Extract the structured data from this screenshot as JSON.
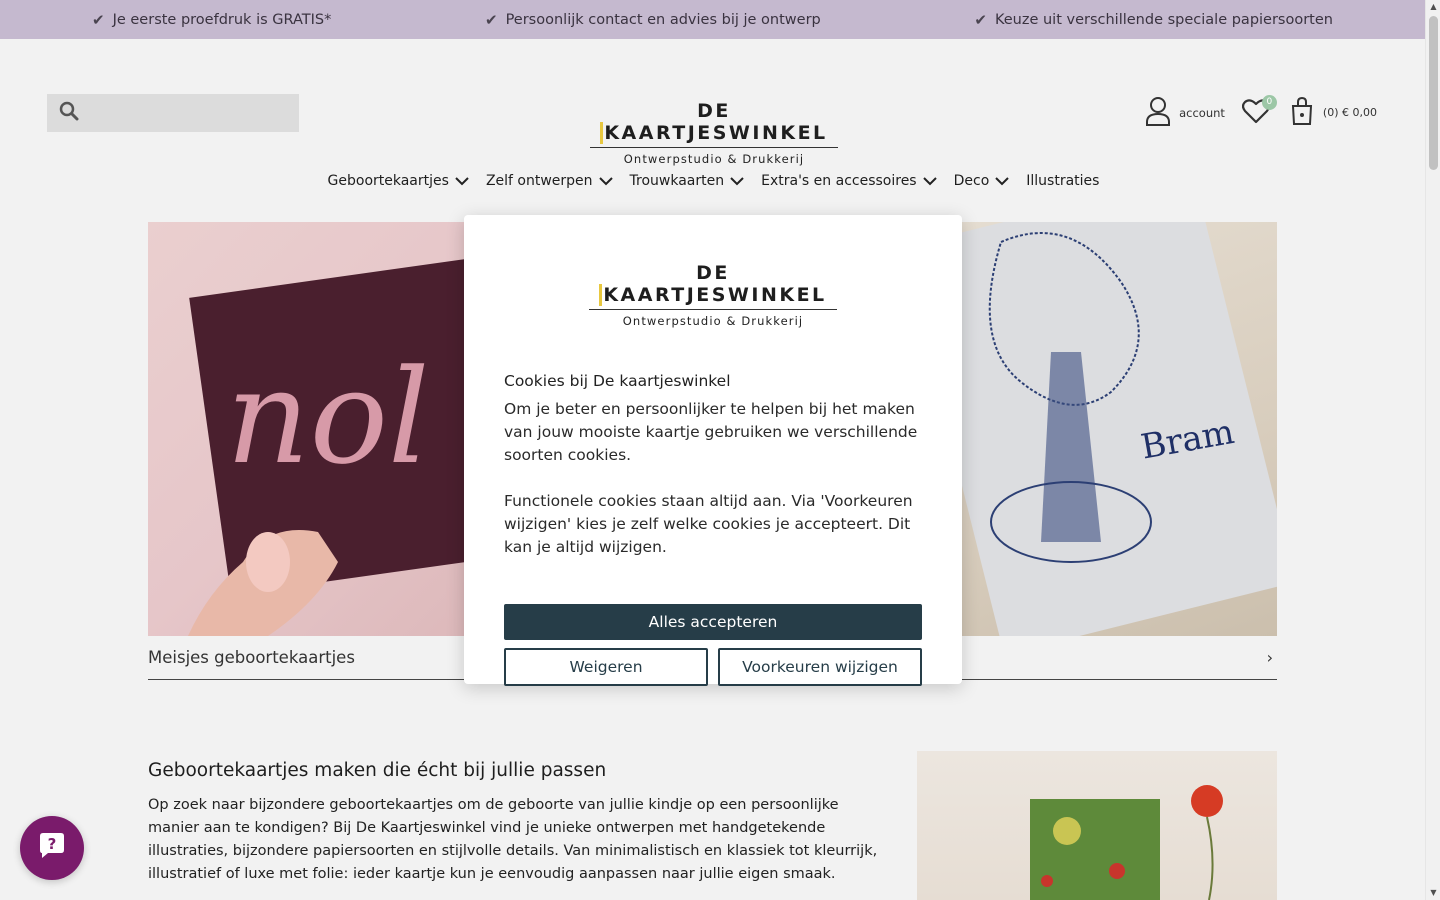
{
  "usp_bar": {
    "items": [
      {
        "icon": "check-icon",
        "text": "Je eerste proefdruk is GRATIS*"
      },
      {
        "icon": "check-icon",
        "text": "Persoonlijk contact en advies bij je ontwerp"
      },
      {
        "icon": "check-icon",
        "text": "Keuze uit verschillende speciale papiersoorten"
      }
    ]
  },
  "header": {
    "search_placeholder": "",
    "logo": {
      "brand_prefix": "DE ",
      "brand_k": "K",
      "brand_rest": "AARTJESWINKEL",
      "subtitle": "Ontwerpstudio & Drukkerij"
    },
    "account_label": "account",
    "wishlist_count": "0",
    "cart_text": "(0)  € 0,00"
  },
  "nav": {
    "items": [
      {
        "label": "Geboortekaartjes",
        "has_dropdown": true
      },
      {
        "label": "Zelf ontwerpen",
        "has_dropdown": true
      },
      {
        "label": "Trouwkaarten",
        "has_dropdown": true
      },
      {
        "label": "Extra's en accessoires",
        "has_dropdown": true
      },
      {
        "label": "Deco",
        "has_dropdown": true
      },
      {
        "label": "Illustraties",
        "has_dropdown": false
      }
    ]
  },
  "hero": {
    "caption": "Meisjes geboortekaartjes",
    "left_card_text": "nol",
    "right_card_text": "Bram"
  },
  "cookie_modal": {
    "title": "Cookies bij De kaartjeswinkel",
    "paragraph1": "Om je beter en persoonlijker te helpen bij het maken van jouw mooiste kaartje gebruiken we verschillende soorten cookies.",
    "paragraph2": "Functionele cookies staan altijd aan. Via 'Voorkeuren wijzigen' kies je zelf welke cookies je accepteert. Dit kan je altijd wijzigen.",
    "accept_label": "Alles accepteren",
    "decline_label": "Weigeren",
    "preferences_label": "Voorkeuren wijzigen"
  },
  "intro": {
    "heading": "Geboortekaartjes maken die écht bij jullie passen",
    "body": "Op zoek naar bijzondere geboortekaartjes om de geboorte van jullie kindje op een persoonlijke manier aan te kondigen? Bij De Kaartjeswinkel vind je unieke ontwerpen met handgetekende illustraties, bijzondere papiersoorten en stijlvolle details. Van minimalistisch en klassiek tot kleurrijk, illustratief of luxe met folie: ieder kaartje kun je eenvoudig aanpassen naar jullie eigen smaak."
  },
  "colors": {
    "usp_bar": "#c5b9cf",
    "accept_button": "#263d48",
    "chat_bubble": "#7a1b6b",
    "wishlist_badge": "#9cc7a6",
    "logo_accent": "#e8c840"
  }
}
